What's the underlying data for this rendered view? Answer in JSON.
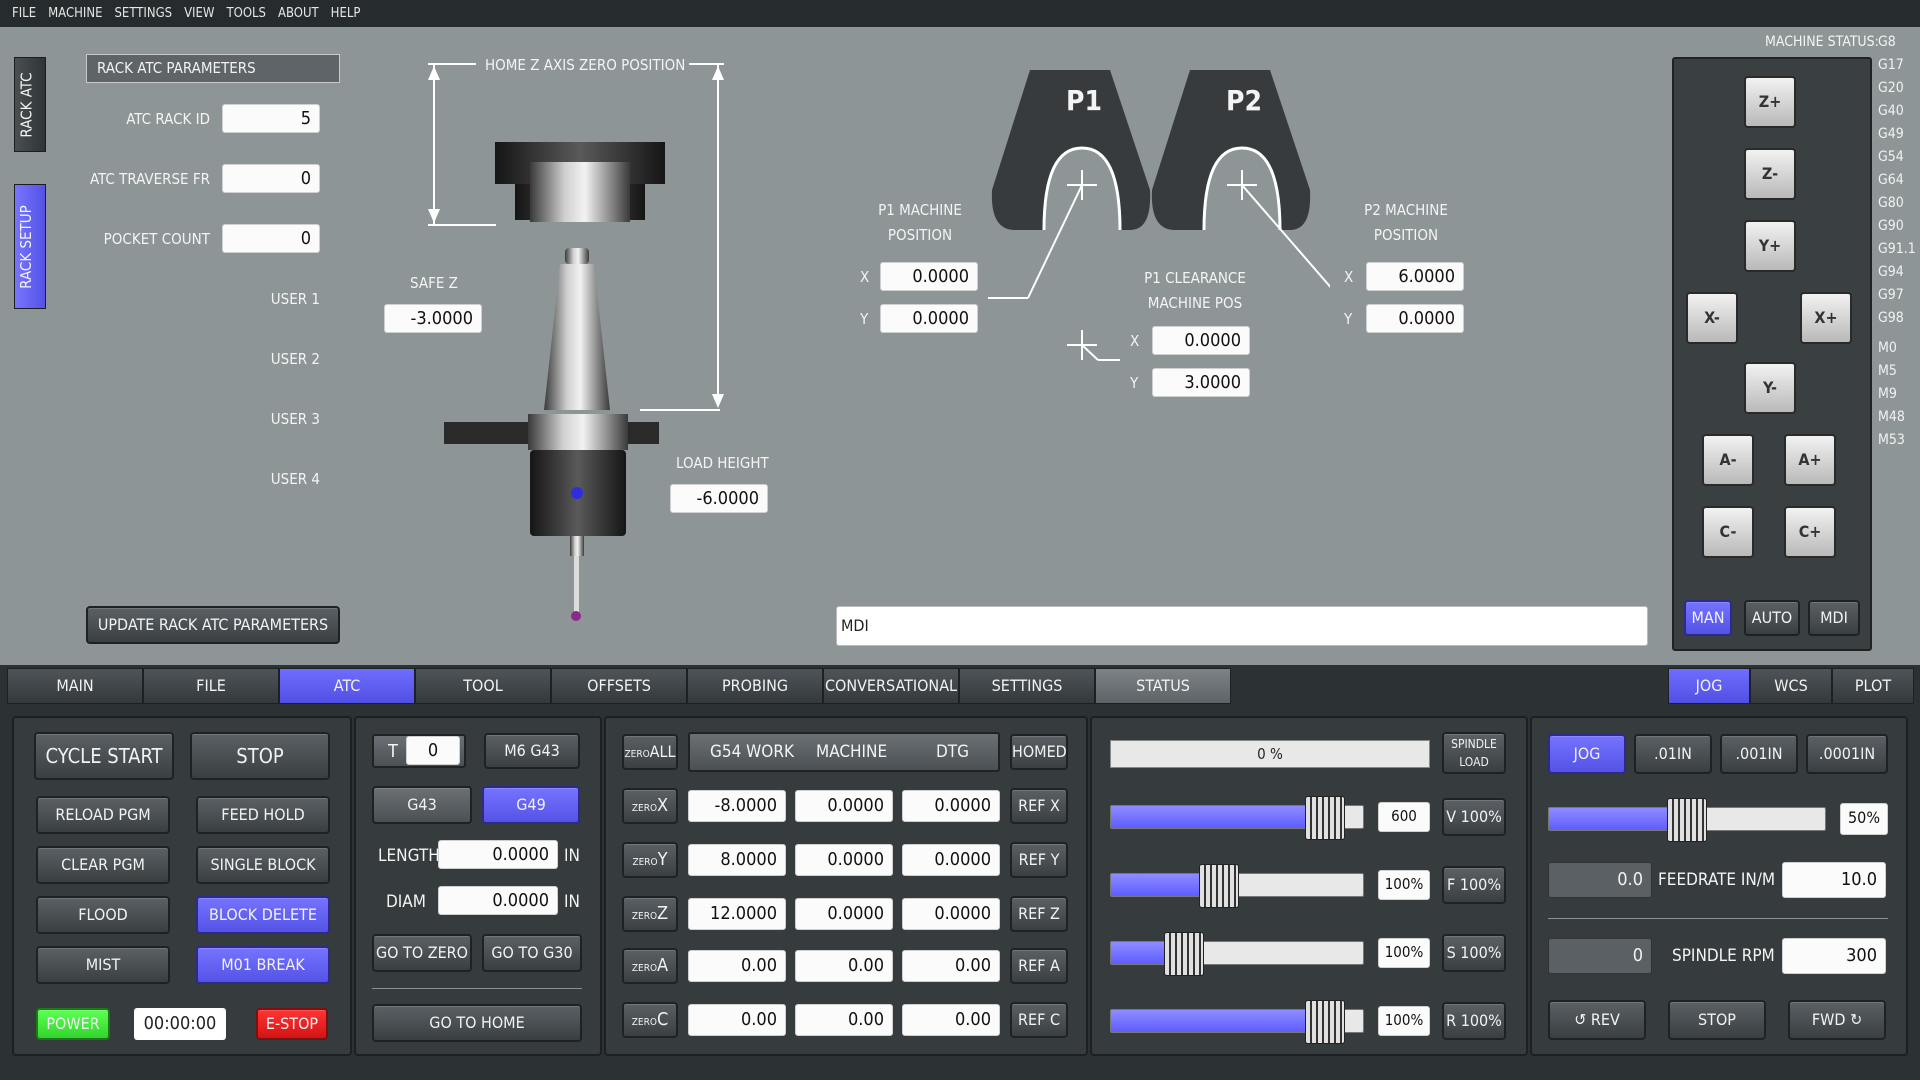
{
  "menu": [
    "FILE",
    "MACHINE",
    "SETTINGS",
    "VIEW",
    "TOOLS",
    "ABOUT",
    "HELP"
  ],
  "side_tabs": {
    "rack_atc": "RACK ATC",
    "rack_setup": "RACK SETUP"
  },
  "rack_params": {
    "title": "RACK ATC PARAMETERS",
    "rack_id_label": "ATC RACK ID",
    "rack_id": "5",
    "traverse_label": "ATC TRAVERSE FR",
    "traverse": "0",
    "pocket_label": "POCKET COUNT",
    "pocket": "0",
    "user1": "USER 1",
    "user2": "USER 2",
    "user3": "USER 3",
    "user4": "USER 4",
    "update_button": "UPDATE RACK ATC PARAMETERS"
  },
  "diagram": {
    "home_z": "HOME Z AXIS ZERO POSITION",
    "safe_z_label": "SAFE Z",
    "safe_z": "-3.0000",
    "load_height_label": "LOAD HEIGHT",
    "load_height": "-6.0000",
    "p1": "P1",
    "p2": "P2",
    "p1_pos_label": "P1 MACHINE POSITION",
    "p1_x": "0.0000",
    "p1_y": "0.0000",
    "p2_pos_label": "P2 MACHINE POSITION",
    "p2_x": "6.0000",
    "p2_y": "0.0000",
    "clear_label": "P1 CLEARANCE MACHINE POS",
    "clear_x": "0.0000",
    "clear_y": "3.0000",
    "x": "X",
    "y": "Y"
  },
  "mdi": {
    "value": "MDI"
  },
  "status": {
    "label": "MACHINE STATUS:",
    "codes": [
      "G8",
      "G17",
      "G20",
      "G40",
      "G49",
      "G54",
      "G64",
      "G80",
      "G90",
      "G91.1",
      "G94",
      "G97",
      "G98",
      "M0",
      "M5",
      "M9",
      "M48",
      "M53"
    ]
  },
  "jog_icons": [
    "Z+",
    "Z-",
    "Y+",
    "X-",
    "X+",
    "Y-",
    "A-",
    "A+",
    "C-",
    "C+"
  ],
  "modes": {
    "man": "MAN",
    "auto": "AUTO",
    "mdi": "MDI"
  },
  "tabs": [
    "MAIN",
    "FILE",
    "ATC",
    "TOOL",
    "OFFSETS",
    "PROBING",
    "CONVERSATIONAL",
    "SETTINGS",
    "STATUS"
  ],
  "right_tabs": [
    "JOG",
    "WCS",
    "PLOT"
  ],
  "control": {
    "cycle_start": "CYCLE START",
    "stop": "STOP",
    "reload": "RELOAD PGM",
    "feed_hold": "FEED HOLD",
    "clear": "CLEAR PGM",
    "single_block": "SINGLE BLOCK",
    "flood": "FLOOD",
    "block_delete": "BLOCK DELETE",
    "mist": "MIST",
    "m01": "M01 BREAK",
    "power": "POWER",
    "timer": "00:00:00",
    "estop": "E-STOP"
  },
  "tool": {
    "t_label": "T",
    "t_value": "0",
    "m6": "M6 G43",
    "g43": "G43",
    "g49": "G49",
    "length_label": "LENGTH",
    "length": "0.0000",
    "diam_label": "DIAM",
    "diam": "0.0000",
    "unit": "IN",
    "go_zero": "GO TO ZERO",
    "go_g30": "GO TO G30",
    "go_home": "GO TO HOME"
  },
  "dro": {
    "zero_all": "ALL",
    "zero_small": "ZERO",
    "homed": "HOMED",
    "headers": [
      "G54 WORK",
      "MACHINE",
      "DTG"
    ],
    "rows": [
      {
        "axis": "X",
        "work": "-8.0000",
        "machine": "0.0000",
        "dtg": "0.0000",
        "ref": "REF X"
      },
      {
        "axis": "Y",
        "work": "8.0000",
        "machine": "0.0000",
        "dtg": "0.0000",
        "ref": "REF Y"
      },
      {
        "axis": "Z",
        "work": "12.0000",
        "machine": "0.0000",
        "dtg": "0.0000",
        "ref": "REF Z"
      },
      {
        "axis": "A",
        "work": "0.00",
        "machine": "0.00",
        "dtg": "0.00",
        "ref": "REF A"
      },
      {
        "axis": "C",
        "work": "0.00",
        "machine": "0.00",
        "dtg": "0.00",
        "ref": "REF C"
      }
    ]
  },
  "overrides": {
    "spindle_load": "0 %",
    "spindle_load_label": "SPINDLE LOAD",
    "rows": [
      {
        "value": "600",
        "button": "V 100%",
        "level": 0.85
      },
      {
        "value": "100%",
        "button": "F 100%",
        "level": 0.43
      },
      {
        "value": "100%",
        "button": "S 100%",
        "level": 0.29
      },
      {
        "value": "100%",
        "button": "R 100%",
        "level": 0.85
      }
    ]
  },
  "jog": {
    "jog": "JOG",
    "inc1": ".01IN",
    "inc2": ".001IN",
    "inc3": ".0001IN",
    "percent": "50%",
    "level": 0.5,
    "feed_actual": "0.0",
    "feed_label": "FEEDRATE IN/M",
    "feed_set": "10.0",
    "rpm_actual": "0",
    "rpm_label": "SPINDLE RPM",
    "rpm_set": "300",
    "rev": "REV",
    "stop": "STOP",
    "fwd": "FWD"
  },
  "colors": {
    "accent": "#5f5dff",
    "upper_bg": "#8e9596",
    "lower_bg": "#363b3e"
  }
}
